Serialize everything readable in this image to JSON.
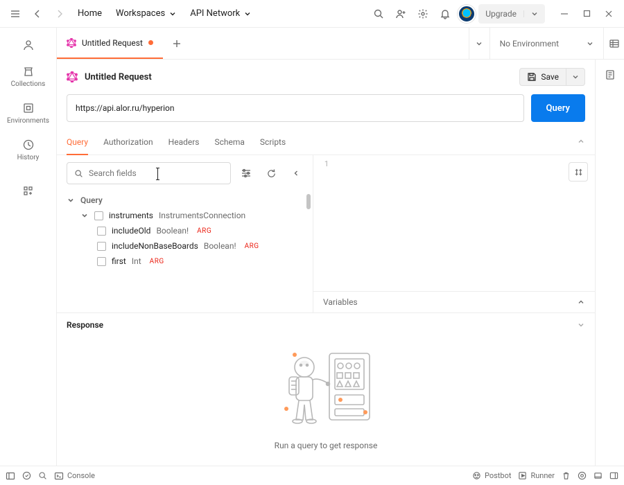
{
  "titlebar": {
    "home": "Home",
    "workspaces": "Workspaces",
    "api_network": "API Network",
    "upgrade": "Upgrade"
  },
  "leftbar": {
    "collections": "Collections",
    "environments": "Environments",
    "history": "History"
  },
  "tabs": {
    "request_name": "Untitled Request",
    "no_env": "No Environment"
  },
  "request": {
    "title": "Untitled Request",
    "save": "Save",
    "url": "https://api.alor.ru/hyperion",
    "query_btn": "Query"
  },
  "subtabs": {
    "query": "Query",
    "authorization": "Authorization",
    "headers": "Headers",
    "schema": "Schema",
    "scripts": "Scripts"
  },
  "schema_panel": {
    "search_placeholder": "Search fields",
    "root": "Query",
    "nodes": {
      "instruments": {
        "name": "instruments",
        "type": "InstrumentsConnection"
      },
      "includeOld": {
        "name": "includeOld",
        "type": "Boolean!",
        "arg": "ARG"
      },
      "includeNonBaseBoards": {
        "name": "includeNonBaseBoards",
        "type": "Boolean!",
        "arg": "ARG"
      },
      "first": {
        "name": "first",
        "type": "Int",
        "arg": "ARG"
      }
    }
  },
  "editor": {
    "line1": "1"
  },
  "variables": {
    "title": "Variables"
  },
  "response": {
    "title": "Response",
    "hint": "Run a query to get response"
  },
  "statusbar": {
    "console": "Console",
    "postbot": "Postbot",
    "runner": "Runner"
  }
}
